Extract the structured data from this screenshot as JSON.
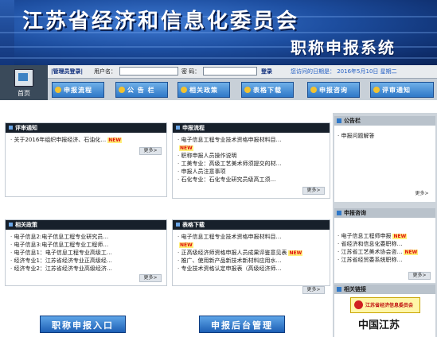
{
  "banner": {
    "title": "江苏省经济和信息化委员会",
    "subtitle": "职称申报系统"
  },
  "home": {
    "label": "首页"
  },
  "login": {
    "title": "|管理员登录|",
    "user_label": "用户名：",
    "user_value": "",
    "pw_label": "密  码：",
    "pw_value": "",
    "button": "登录",
    "date": "您访问的日期是：  2016年5月10日  星期二"
  },
  "nav": [
    "申报流程",
    "公 告 栏",
    "相关政策",
    "表格下载",
    "申报咨询",
    "评审通知"
  ],
  "panels": {
    "review": {
      "title": "评审通知",
      "items": [
        {
          "text": "关于2016年组织申报经济、石油化…",
          "new": "NEW"
        }
      ],
      "more": "更多>"
    },
    "process": {
      "title": "申报流程",
      "items": [
        {
          "text": "电子信息工程专业技术资格申报材料目…",
          "new": "NEW"
        },
        {
          "text": "职称申报人员操作说明",
          "new": ""
        },
        {
          "text": "工美专业：高级工艺美术师须提交的材…",
          "new": ""
        },
        {
          "text": "申报人员注意事项",
          "new": ""
        },
        {
          "text": "石化专业：石化专业研究员级高工须…",
          "new": ""
        }
      ],
      "more": "更多>"
    },
    "policy": {
      "title": "相关政策",
      "items": [
        {
          "text": "电子信息2:电子信息工程专业研究员…",
          "new": ""
        },
        {
          "text": "电子信息3:电子信息工程专业工程师…",
          "new": ""
        },
        {
          "text": "电子信息1：电子信息工程专业高级工…",
          "new": ""
        },
        {
          "text": "经济专业1：江苏省经济专业正高级经…",
          "new": ""
        },
        {
          "text": "经济专业2：江苏省经济专业高级经济…",
          "new": ""
        }
      ],
      "more": "更多>"
    },
    "forms": {
      "title": "表格下载",
      "items": [
        {
          "text": "电子信息工程专业技术资格申报材料目…",
          "new": "NEW"
        },
        {
          "text": "正高级经济师资格申报人员成果评鉴意见表",
          "new": "NEW"
        },
        {
          "text": "推广、使用新产品新技术新材料应用水…",
          "new": ""
        },
        {
          "text": "专业技术资格认定申报表（高级经济师…",
          "new": ""
        }
      ],
      "more": "更多>"
    }
  },
  "sidebar": {
    "notice": {
      "title": "公告栏",
      "items": [
        "申报问题解答"
      ],
      "more": "更多>"
    },
    "consult": {
      "title": "申报咨询",
      "items": [
        {
          "text": "电子信息工程师申报",
          "new": "NEW"
        },
        {
          "text": "省经济和信息化委职称…",
          "new": ""
        },
        {
          "text": "江苏省工艺美术协会咨…",
          "new": "NEW"
        },
        {
          "text": "江苏省经贸委系统职称…",
          "new": ""
        }
      ],
      "more": "更多>"
    },
    "links": {
      "title": "相关链接",
      "logo1": "江苏省经济信息委员会",
      "logo2": "中国江苏"
    }
  },
  "bottom": {
    "left_btn": "职称申报入口",
    "right_btn": "申报后台管理"
  }
}
